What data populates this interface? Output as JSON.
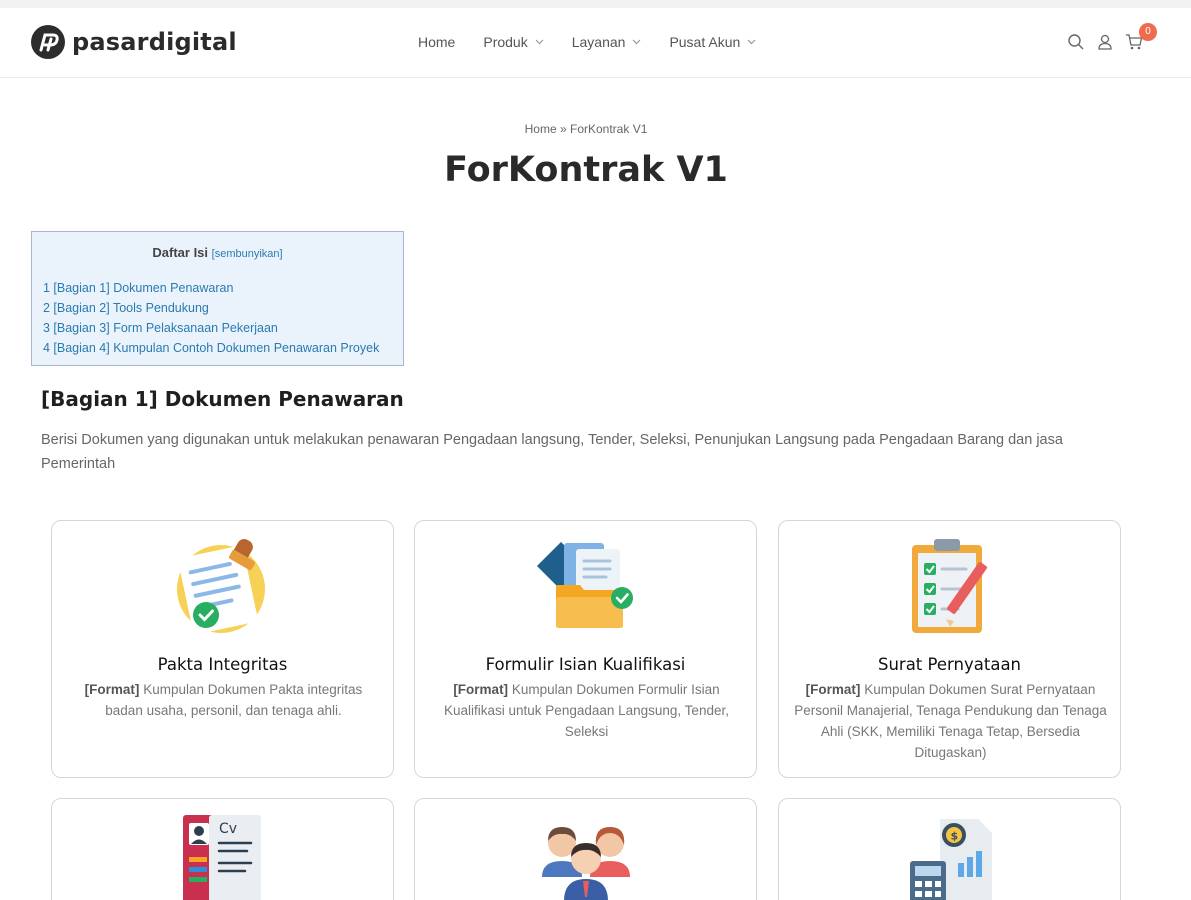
{
  "brand": {
    "name": "pasardigital"
  },
  "nav": {
    "items": [
      {
        "label": "Home"
      },
      {
        "label": "Produk"
      },
      {
        "label": "Layanan"
      },
      {
        "label": "Pusat Akun"
      }
    ]
  },
  "header": {
    "cart_count": "0",
    "icons": [
      "search-icon",
      "user-icon",
      "cart-icon"
    ]
  },
  "breadcrumb": {
    "home": "Home",
    "separator": "»",
    "current": "ForKontrak V1"
  },
  "page": {
    "title": "ForKontrak V1"
  },
  "toc": {
    "title": "Daftar Isi",
    "toggle": "[sembunyikan]",
    "items": [
      {
        "label": "1 [Bagian 1] Dokumen Penawaran"
      },
      {
        "label": "2 [Bagian 2] Tools Pendukung"
      },
      {
        "label": "3 [Bagian 3] Form Pelaksanaan Pekerjaan"
      },
      {
        "label": "4 [Bagian 4] Kumpulan Contoh Dokumen Penawaran Proyek"
      }
    ]
  },
  "section": {
    "heading": "[Bagian 1] Dokumen Penawaran",
    "description": "Berisi Dokumen yang digunakan untuk melakukan penawaran Pengadaan langsung, Tender, Seleksi, Penunjukan Langsung pada Pengadaan Barang dan jasa Pemerintah"
  },
  "cards": [
    {
      "title": "Pakta Integritas",
      "tag": "[Format]",
      "desc": "Kumpulan Dokumen Pakta integritas badan usaha, personil, dan tenaga ahli.",
      "icon": "stamp-document-icon"
    },
    {
      "title": "Formulir Isian Kualifikasi",
      "tag": "[Format]",
      "desc": "Kumpulan Dokumen Formulir Isian Kualifikasi untuk Pengadaan Langsung, Tender, Seleksi",
      "icon": "folder-check-icon"
    },
    {
      "title": "Surat Pernyataan",
      "tag": "[Format]",
      "desc": "Kumpulan Dokumen Surat Pernyataan Personil Manajerial, Tenaga Pendukung dan Tenaga Ahli (SKK, Memiliki Tenaga Tetap, Bersedia Ditugaskan)",
      "icon": "clipboard-checklist-icon"
    },
    {
      "title": "",
      "tag": "",
      "desc": "",
      "icon": "cv-document-icon"
    },
    {
      "title": "",
      "tag": "",
      "desc": "",
      "icon": "team-people-icon"
    },
    {
      "title": "",
      "tag": "",
      "desc": "",
      "icon": "finance-report-icon"
    }
  ],
  "colors": {
    "accent_link": "#2a7ab0",
    "badge": "#ee6c4d",
    "toc_bg": "#eaf3fc"
  }
}
